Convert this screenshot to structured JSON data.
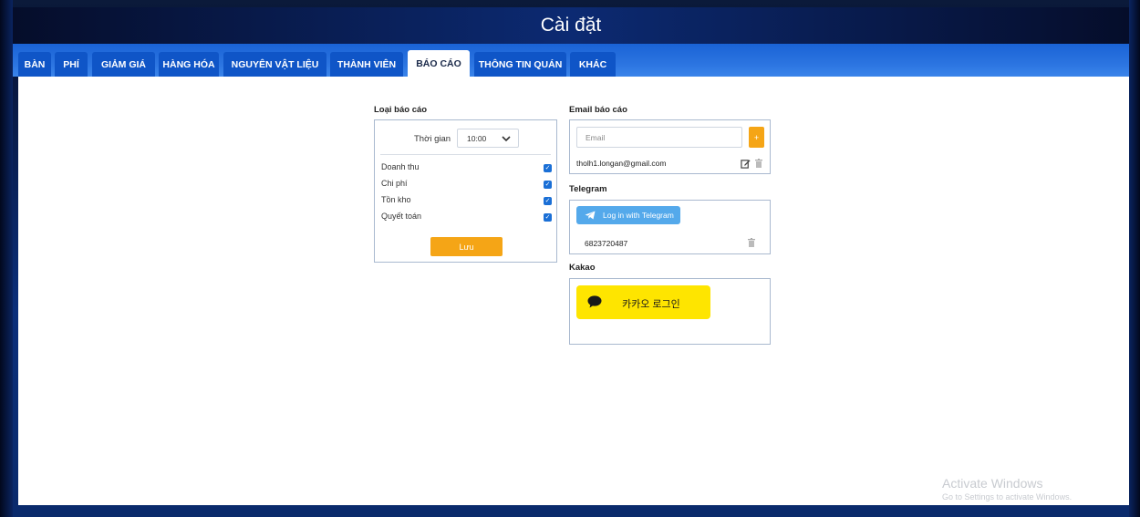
{
  "window": {
    "title": "Cài đặt"
  },
  "tabs": [
    {
      "label": "BÀN"
    },
    {
      "label": "PHÍ"
    },
    {
      "label": "GIẢM GIÁ"
    },
    {
      "label": "HÀNG HÓA"
    },
    {
      "label": "NGUYÊN VẬT LIỆU"
    },
    {
      "label": "THÀNH VIÊN"
    },
    {
      "label": "BÁO CÁO",
      "active": true
    },
    {
      "label": "THÔNG TIN QUÁN"
    },
    {
      "label": "KHÁC"
    }
  ],
  "report": {
    "section_title": "Loại báo cáo",
    "time_label": "Thời gian",
    "time_value": "10:00",
    "items": [
      {
        "label": "Doanh thu",
        "checked": true
      },
      {
        "label": "Chi phí",
        "checked": true
      },
      {
        "label": "Tồn kho",
        "checked": true
      },
      {
        "label": "Quyết toán",
        "checked": true
      }
    ],
    "save_label": "Lưu"
  },
  "email": {
    "section_title": "Email báo cáo",
    "placeholder": "Email",
    "add_label": "+",
    "entries": [
      "tholh1.longan@gmail.com"
    ]
  },
  "telegram": {
    "section_title": "Telegram",
    "login_label": "Log in with Telegram",
    "entries": [
      "6823720487"
    ]
  },
  "kakao": {
    "section_title": "Kakao",
    "login_label": "카카오 로그인"
  },
  "watermark": {
    "line1": "Activate Windows",
    "line2": "Go to Settings to activate Windows."
  },
  "colors": {
    "accent_orange": "#f5a516",
    "tab_blue": "#0f55c7",
    "telegram_blue": "#54a9eb",
    "kakao_yellow": "#fee500",
    "checkbox_blue": "#1a6fd6"
  }
}
